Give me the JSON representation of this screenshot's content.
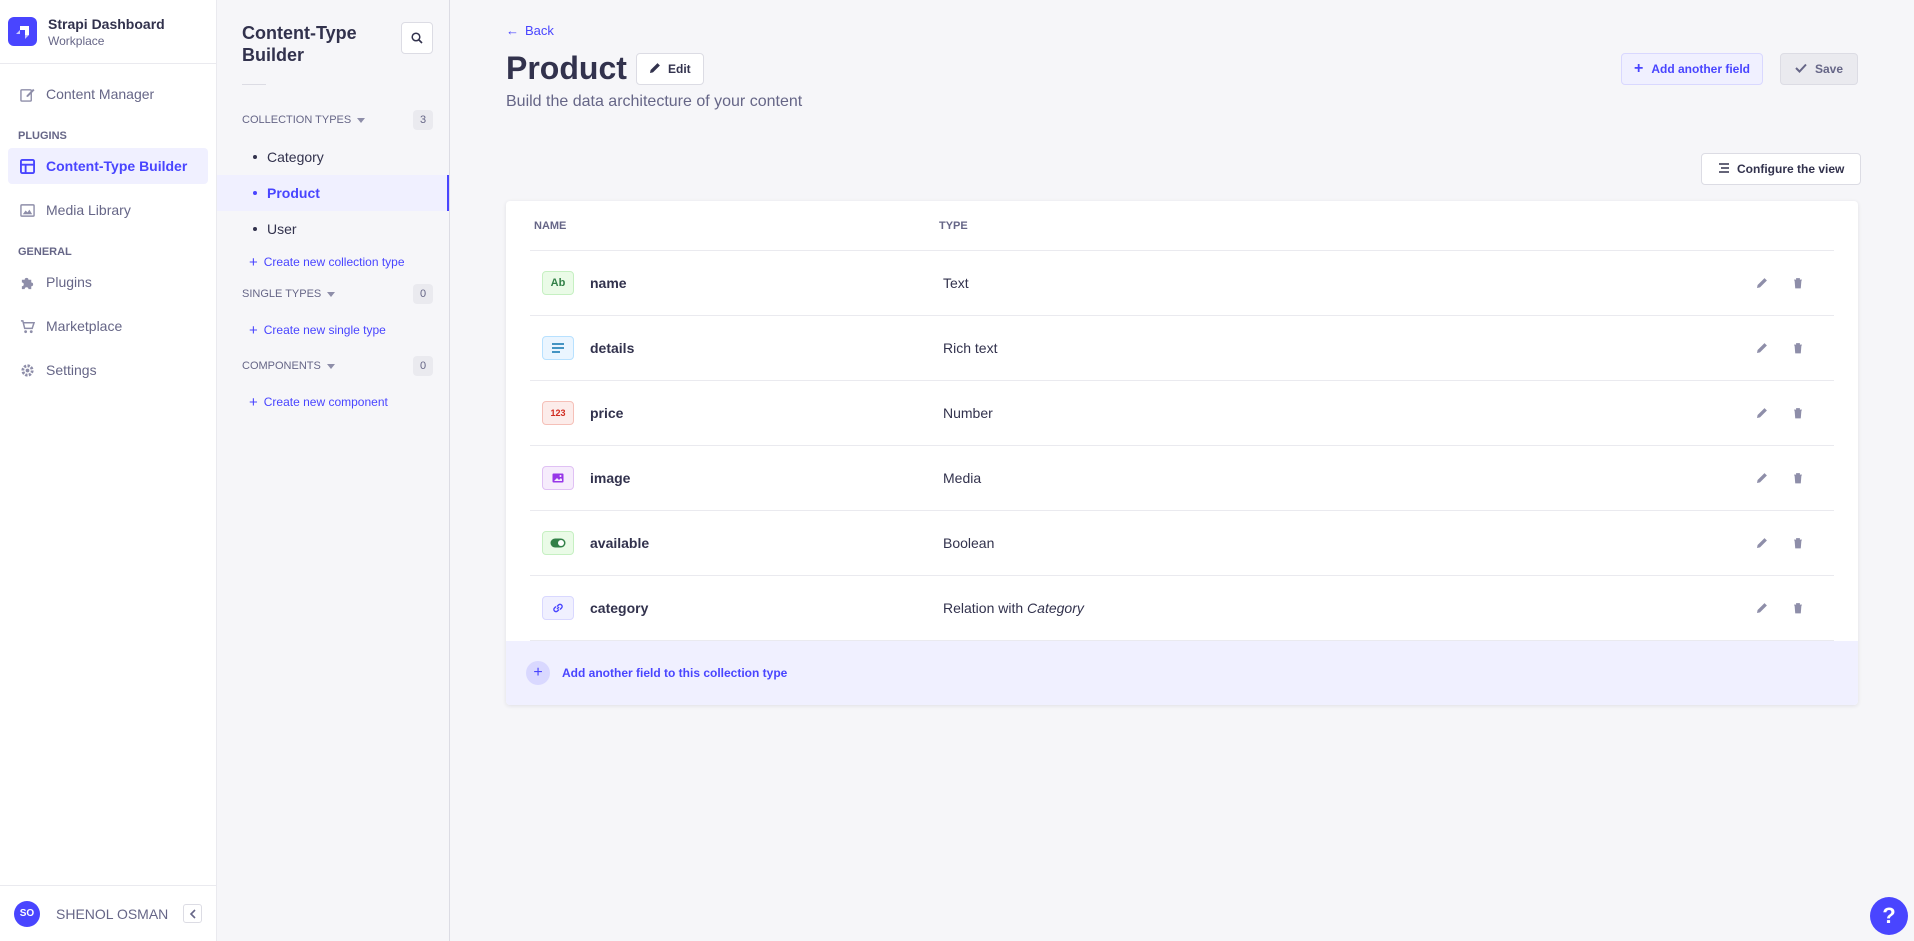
{
  "brand": {
    "title": "Strapi Dashboard",
    "subtitle": "Workplace"
  },
  "mainnav": {
    "content_manager": "Content Manager",
    "plugins_section": "PLUGINS",
    "content_type_builder": "Content-Type Builder",
    "media_library": "Media Library",
    "general_section": "GENERAL",
    "plugins": "Plugins",
    "marketplace": "Marketplace",
    "settings": "Settings"
  },
  "user": {
    "initials": "SO",
    "name": "SHENOL OSMAN"
  },
  "subnav": {
    "title": "Content-Type Builder",
    "collection_types": {
      "label": "COLLECTION TYPES",
      "count": "3",
      "items": [
        "Category",
        "Product",
        "User"
      ],
      "create": "Create new collection type"
    },
    "single_types": {
      "label": "SINGLE TYPES",
      "count": "0",
      "create": "Create new single type"
    },
    "components": {
      "label": "COMPONENTS",
      "count": "0",
      "create": "Create new component"
    }
  },
  "header": {
    "back": "Back",
    "title": "Product",
    "edit": "Edit",
    "subtitle": "Build the data architecture of your content",
    "add_field": "Add another field",
    "save": "Save",
    "configure": "Configure the view"
  },
  "table": {
    "col_name": "NAME",
    "col_type": "TYPE",
    "rows": [
      {
        "icon": "text-icon",
        "icon_text": "Ab",
        "name": "name",
        "type": "Text"
      },
      {
        "icon": "richtext-icon",
        "icon_text": "",
        "name": "details",
        "type": "Rich text"
      },
      {
        "icon": "number-icon",
        "icon_text": "123",
        "name": "price",
        "type": "Number"
      },
      {
        "icon": "media-icon",
        "icon_text": "",
        "name": "image",
        "type": "Media"
      },
      {
        "icon": "boolean-icon",
        "icon_text": "",
        "name": "available",
        "type": "Boolean"
      },
      {
        "icon": "relation-icon",
        "icon_text": "",
        "name": "category",
        "type": "Relation with",
        "type_target": "Category"
      }
    ],
    "add_row": "Add another field to this collection type"
  },
  "help": "?",
  "colors": {
    "primary": "#4945ff",
    "primary_light": "#f0f0ff",
    "border": "#dcdce4"
  }
}
